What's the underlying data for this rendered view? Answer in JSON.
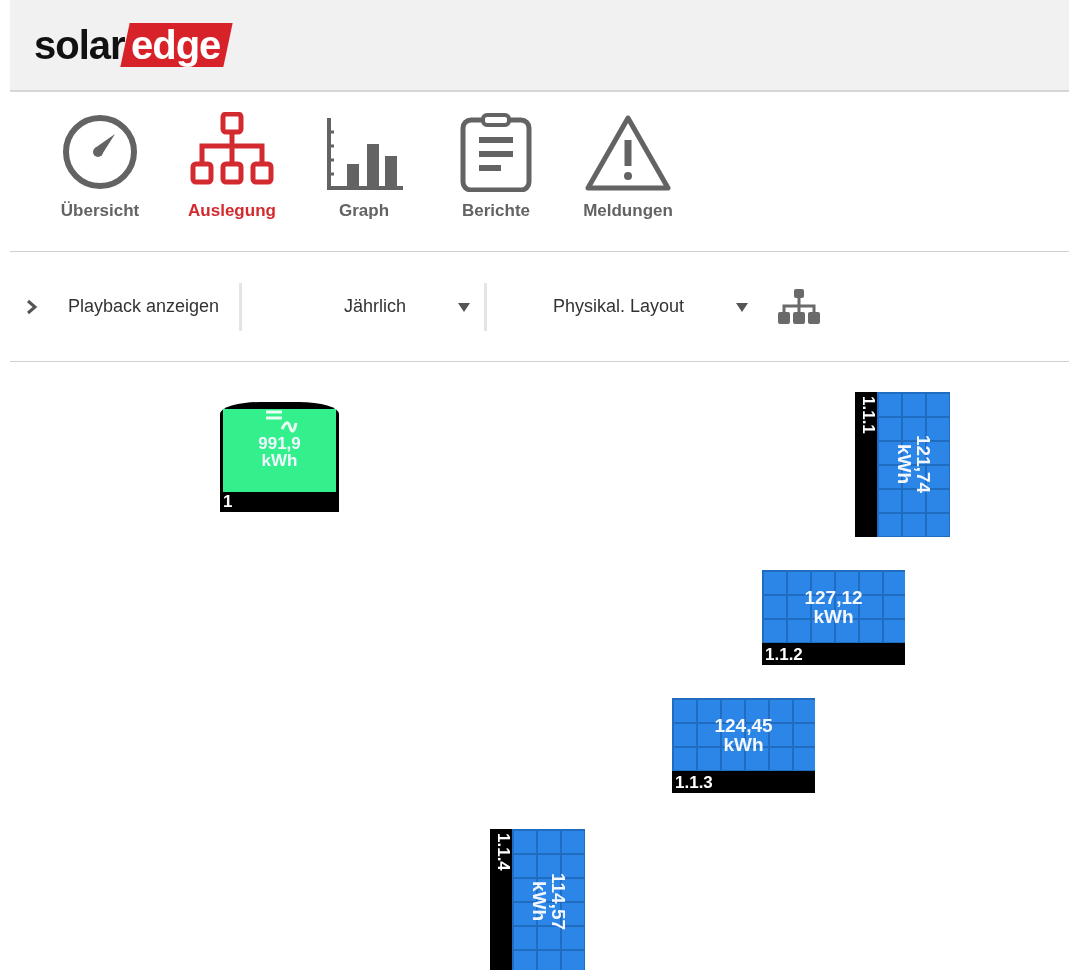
{
  "logo": {
    "part_1": "solar",
    "part_2": "edge"
  },
  "tabs": [
    {
      "label": "Übersicht",
      "kind": "gauge",
      "selected": false
    },
    {
      "label": "Auslegung",
      "kind": "tree",
      "selected": true
    },
    {
      "label": "Graph",
      "kind": "bars",
      "selected": false
    },
    {
      "label": "Berichte",
      "kind": "clipboard",
      "selected": false
    },
    {
      "label": "Meldungen",
      "kind": "warning",
      "selected": false
    }
  ],
  "toolbar": {
    "playback": {
      "label": "Playback anzeigen",
      "expanded": false
    },
    "dropdowns": [
      {
        "value": "Jährlich"
      },
      {
        "value": "Physikal. Layout"
      }
    ]
  },
  "layout": [
    {
      "kind": "inverter",
      "id_label": "1",
      "energy": "991,9",
      "unit": "kWh"
    },
    {
      "kind": "portrait",
      "id_label": "1.1.1",
      "energy": "121,74",
      "unit": "kWh"
    },
    {
      "kind": "landscape",
      "id_label": "1.1.2",
      "energy": "127,12",
      "unit": "kWh"
    },
    {
      "kind": "landscape",
      "id_label": "1.1.3",
      "energy": "124,45",
      "unit": "kWh"
    },
    {
      "kind": "portrait",
      "id_label": "1.1.4",
      "energy": "114,57",
      "unit": "kWh"
    }
  ]
}
